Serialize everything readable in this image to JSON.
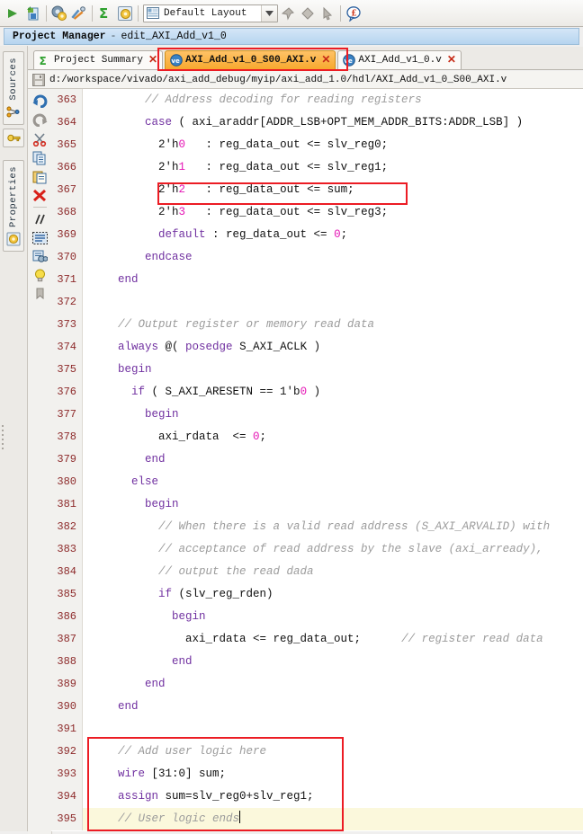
{
  "toolbar": {
    "icons": [
      {
        "name": "run-arrow-icon",
        "glyph": "▶"
      },
      {
        "name": "report-icon",
        "glyph": "▤"
      },
      {
        "name": "settings-gear-icon",
        "glyph": "⚙"
      },
      {
        "name": "tools-icon",
        "glyph": "✂"
      },
      {
        "name": "sigma-icon",
        "glyph": "Σ"
      },
      {
        "name": "ip-settings-icon",
        "glyph": "⚙"
      }
    ],
    "layout_select": {
      "label": "Default Layout",
      "arrow": "▼",
      "icon": "layout-icon"
    },
    "right_icons": [
      {
        "name": "pin-icon",
        "glyph": "❑"
      },
      {
        "name": "diamond-icon",
        "glyph": "◆"
      },
      {
        "name": "cursor-arrow-icon",
        "glyph": "➤"
      },
      {
        "name": "help-tip-icon",
        "glyph": "ⓘ"
      }
    ]
  },
  "panel": {
    "title": "Project Manager",
    "separator": "-",
    "subtitle": "edit_AXI_Add_v1_0"
  },
  "sidebar": {
    "groups": [
      {
        "label": "Sources",
        "name": "sidebar-group-sources",
        "icon": "network-nodes-icon",
        "button_icon": "key-icon"
      },
      {
        "label": "Properties",
        "name": "sidebar-group-properties",
        "icon": "properties-gear-icon",
        "button_icon": ""
      }
    ]
  },
  "tabs": [
    {
      "label": "Project Summary",
      "icon": "sigma-summary-icon",
      "close": "✕",
      "active": false,
      "name": "tab-project-summary"
    },
    {
      "label": "AXI_Add_v1_0_S00_AXI.v",
      "icon": "verilog-file-icon",
      "close": "✕",
      "active": true,
      "name": "tab-axi-add-v1-0-s00-axi"
    },
    {
      "label": "AXI_Add_v1_0.v",
      "icon": "verilog-file-icon",
      "close": "✕",
      "active": false,
      "name": "tab-axi-add-v1-0"
    }
  ],
  "path_bar": {
    "icon": "save-file-icon",
    "path": "d:/workspace/vivado/axi_add_debug/myip/axi_add_1.0/hdl/AXI_Add_v1_0_S00_AXI.v"
  },
  "gutter_icons": [
    {
      "name": "undo-icon",
      "glyph": "↶"
    },
    {
      "name": "redo-icon",
      "glyph": "↷"
    },
    {
      "name": "cut-scissors-icon",
      "glyph": "✂"
    },
    {
      "name": "copy-icon",
      "glyph": "❐"
    },
    {
      "name": "paste-icon",
      "glyph": "ὌB"
    },
    {
      "name": "delete-x-icon",
      "glyph": "✕"
    },
    {
      "name": "comment-slashes-icon",
      "glyph": "//"
    },
    {
      "name": "select-block-icon",
      "glyph": "≣"
    },
    {
      "name": "find-binoculars-icon",
      "glyph": "☿"
    },
    {
      "name": "lightbulb-icon",
      "glyph": "●"
    },
    {
      "name": "bookmark-icon",
      "glyph": "⚑"
    }
  ],
  "editor": {
    "colors": {
      "keyword": "#7030a0",
      "comment": "#9b9b9b",
      "number": "#e515b5",
      "lineno": "#8d2a2a",
      "annotation": "#ec1c24",
      "cursorline": "#fbf8dc",
      "active_tab": "#f7a92e"
    },
    "lines": [
      {
        "no": "363",
        "code": "        // Address decoding for reading registers",
        "highlight": false
      },
      {
        "no": "364",
        "code": "        case ( axi_araddr[ADDR_LSB+OPT_MEM_ADDR_BITS:ADDR_LSB] )",
        "highlight": false
      },
      {
        "no": "365",
        "code": "          2'h0   : reg_data_out <= slv_reg0;",
        "highlight": false
      },
      {
        "no": "366",
        "code": "          2'h1   : reg_data_out <= slv_reg1;",
        "highlight": false
      },
      {
        "no": "367",
        "code": "          2'h2   : reg_data_out <= sum;",
        "highlight": false
      },
      {
        "no": "368",
        "code": "          2'h3   : reg_data_out <= slv_reg3;",
        "highlight": false
      },
      {
        "no": "369",
        "code": "          default : reg_data_out <= 0;",
        "highlight": false
      },
      {
        "no": "370",
        "code": "        endcase",
        "highlight": false
      },
      {
        "no": "371",
        "code": "    end",
        "highlight": false
      },
      {
        "no": "372",
        "code": "",
        "highlight": false
      },
      {
        "no": "373",
        "code": "    // Output register or memory read data",
        "highlight": false
      },
      {
        "no": "374",
        "code": "    always @( posedge S_AXI_ACLK )",
        "highlight": false
      },
      {
        "no": "375",
        "code": "    begin",
        "highlight": false
      },
      {
        "no": "376",
        "code": "      if ( S_AXI_ARESETN == 1'b0 )",
        "highlight": false
      },
      {
        "no": "377",
        "code": "        begin",
        "highlight": false
      },
      {
        "no": "378",
        "code": "          axi_rdata  <= 0;",
        "highlight": false
      },
      {
        "no": "379",
        "code": "        end",
        "highlight": false
      },
      {
        "no": "380",
        "code": "      else",
        "highlight": false
      },
      {
        "no": "381",
        "code": "        begin",
        "highlight": false
      },
      {
        "no": "382",
        "code": "          // When there is a valid read address (S_AXI_ARVALID) with",
        "highlight": false
      },
      {
        "no": "383",
        "code": "          // acceptance of read address by the slave (axi_arready),",
        "highlight": false
      },
      {
        "no": "384",
        "code": "          // output the read dada",
        "highlight": false
      },
      {
        "no": "385",
        "code": "          if (slv_reg_rden)",
        "highlight": false
      },
      {
        "no": "386",
        "code": "            begin",
        "highlight": false
      },
      {
        "no": "387",
        "code": "              axi_rdata <= reg_data_out;      // register read data",
        "highlight": false
      },
      {
        "no": "388",
        "code": "            end",
        "highlight": false
      },
      {
        "no": "389",
        "code": "        end",
        "highlight": false
      },
      {
        "no": "390",
        "code": "    end",
        "highlight": false
      },
      {
        "no": "391",
        "code": "",
        "highlight": false
      },
      {
        "no": "392",
        "code": "    // Add user logic here",
        "highlight": false
      },
      {
        "no": "393",
        "code": "    wire [31:0] sum;",
        "highlight": false
      },
      {
        "no": "394",
        "code": "    assign sum=slv_reg0+slv_reg1;",
        "highlight": false
      },
      {
        "no": "395",
        "code": "    // User logic ends",
        "highlight": true
      }
    ]
  },
  "annotations": [
    {
      "name": "annotation-box-active-tab",
      "target": "tab-axi-add-v1-0-s00-axi"
    },
    {
      "name": "annotation-box-line-367",
      "target": "line-367"
    },
    {
      "name": "annotation-box-user-logic",
      "target": "lines-392-395"
    }
  ]
}
